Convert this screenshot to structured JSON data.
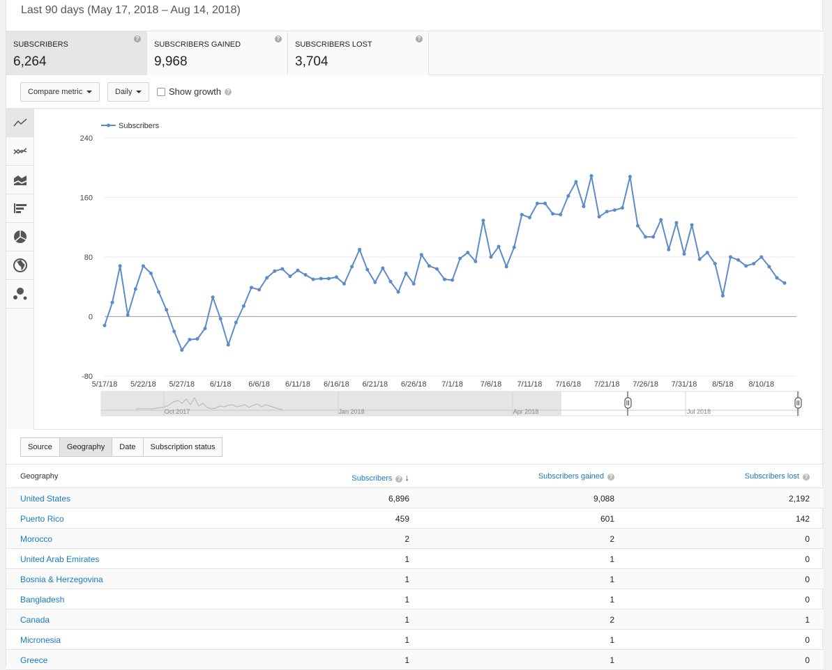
{
  "header": {
    "date_range": "Last 90 days (May 17, 2018 – Aug 14, 2018)"
  },
  "metric_cards": [
    {
      "label": "SUBSCRIBERS",
      "value": "6,264"
    },
    {
      "label": "SUBSCRIBERS GAINED",
      "value": "9,968"
    },
    {
      "label": "SUBSCRIBERS LOST",
      "value": "3,704"
    }
  ],
  "toolbar": {
    "compare_metric": "Compare metric",
    "interval": "Daily",
    "show_growth": "Show growth"
  },
  "sidebar_icons": [
    "line-chart-icon",
    "multiline-chart-icon",
    "stacked-area-icon",
    "bar-chart-icon",
    "pie-chart-icon",
    "globe-map-icon",
    "bubble-chart-icon"
  ],
  "chart_data": {
    "type": "line",
    "series": [
      {
        "name": "Subscribers",
        "color": "#5b8bc9",
        "values": [
          -12,
          19,
          68,
          2,
          37,
          68,
          58,
          33,
          9,
          -20,
          -45,
          -31,
          -30,
          -16,
          26,
          -3,
          -38,
          -8,
          14,
          39,
          36,
          52,
          61,
          64,
          54,
          62,
          56,
          50,
          51,
          51,
          53,
          44,
          67,
          90,
          63,
          46,
          65,
          47,
          33,
          58,
          44,
          83,
          68,
          64,
          50,
          49,
          78,
          86,
          74,
          129,
          80,
          94,
          67,
          93,
          137,
          133,
          152,
          152,
          138,
          137,
          162,
          181,
          148,
          189,
          134,
          141,
          143,
          146,
          188,
          122,
          107,
          107,
          130,
          90,
          126,
          84,
          123,
          77,
          86,
          71,
          28,
          80,
          76,
          68,
          71,
          80,
          67,
          52,
          45
        ]
      }
    ],
    "x": [
      "5/17/18",
      "5/22/18",
      "5/27/18",
      "6/1/18",
      "6/6/18",
      "6/11/18",
      "6/16/18",
      "6/21/18",
      "6/26/18",
      "7/1/18",
      "7/6/18",
      "7/11/18",
      "7/16/18",
      "7/21/18",
      "7/26/18",
      "7/31/18",
      "8/5/18",
      "8/10/18"
    ],
    "yticks": [
      "240",
      "160",
      "80",
      "0",
      "-80"
    ],
    "ylim": [
      -80,
      240
    ],
    "legend_position": "top-left",
    "grid": true,
    "timeline_labels": [
      "Oct 2017",
      "Jan 2018",
      "Apr 2018",
      "Jul 2018"
    ]
  },
  "tabs": [
    "Source",
    "Geography",
    "Date",
    "Subscription status"
  ],
  "table": {
    "headers": [
      "Geography",
      "Subscribers",
      "Subscribers gained",
      "Subscribers lost"
    ],
    "rows": [
      [
        "United States",
        "6,896",
        "9,088",
        "2,192"
      ],
      [
        "Puerto Rico",
        "459",
        "601",
        "142"
      ],
      [
        "Morocco",
        "2",
        "2",
        "0"
      ],
      [
        "United Arab Emirates",
        "1",
        "1",
        "0"
      ],
      [
        "Bosnia & Herzegovina",
        "1",
        "1",
        "0"
      ],
      [
        "Bangladesh",
        "1",
        "1",
        "0"
      ],
      [
        "Canada",
        "1",
        "2",
        "1"
      ],
      [
        "Micronesia",
        "1",
        "1",
        "0"
      ],
      [
        "Greece",
        "1",
        "1",
        "0"
      ]
    ]
  }
}
